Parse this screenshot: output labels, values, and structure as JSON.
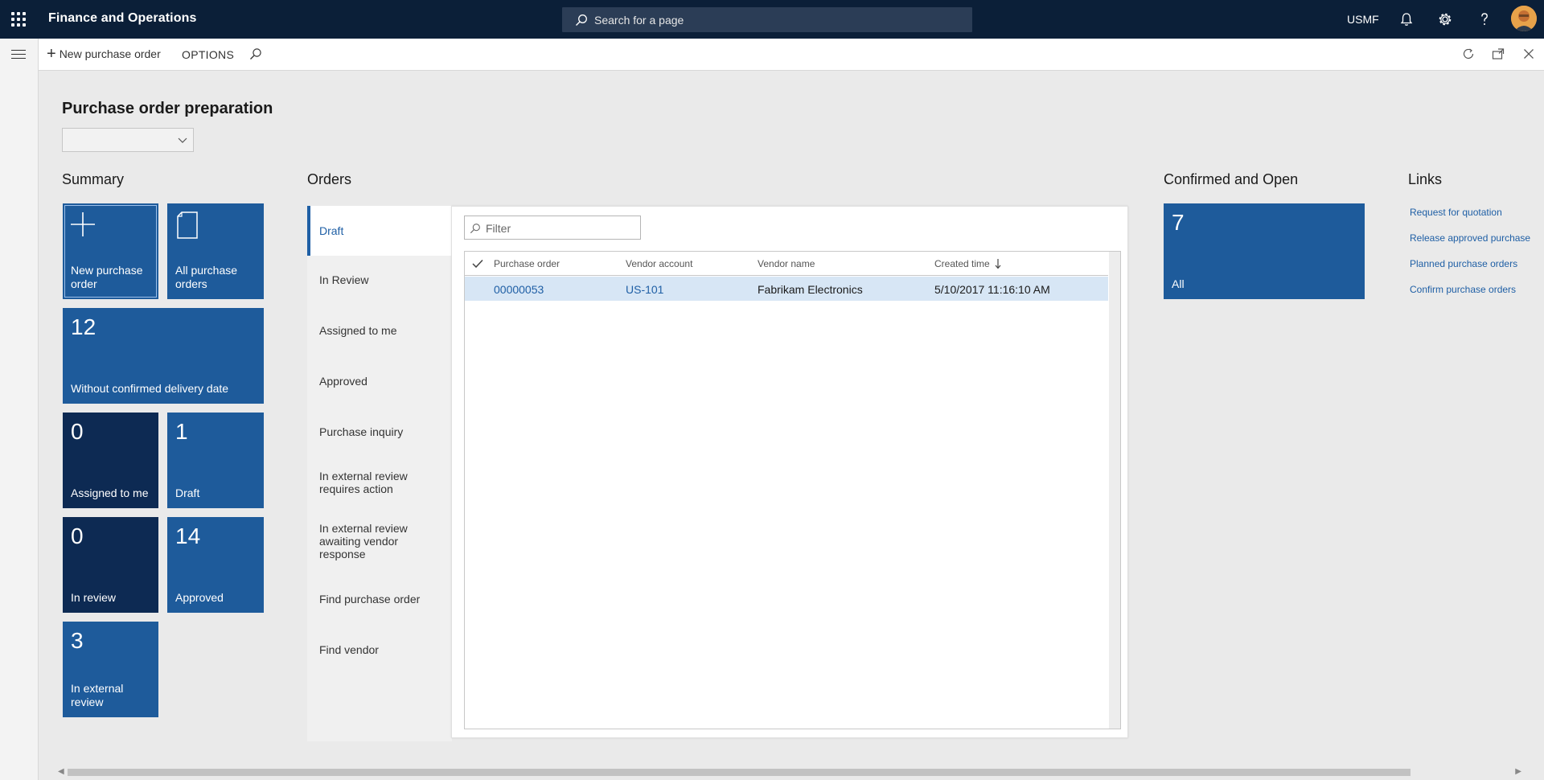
{
  "app": {
    "title": "Finance and Operations",
    "search_placeholder": "Search for a page",
    "company": "USMF"
  },
  "actions": {
    "new_purchase_order": "New purchase order",
    "options": "OPTIONS"
  },
  "page": {
    "title": "Purchase order preparation",
    "dropdown_value": ""
  },
  "summary": {
    "title": "Summary",
    "tiles": [
      {
        "count": "",
        "label": "New purchase order"
      },
      {
        "count": "",
        "label": "All purchase orders"
      },
      {
        "count": "12",
        "label": "Without confirmed delivery date"
      },
      {
        "count": "0",
        "label": "Assigned to me"
      },
      {
        "count": "1",
        "label": "Draft"
      },
      {
        "count": "0",
        "label": "In review"
      },
      {
        "count": "14",
        "label": "Approved"
      },
      {
        "count": "3",
        "label": "In external review"
      }
    ]
  },
  "orders": {
    "title": "Orders",
    "tabs": [
      "Draft",
      "In Review",
      "Assigned to me",
      "Approved",
      "Purchase inquiry",
      "In external review requires action",
      "In external review awaiting vendor response",
      "Find purchase order",
      "Find vendor"
    ],
    "filter_placeholder": "Filter",
    "columns": [
      "Purchase order",
      "Vendor account",
      "Vendor name",
      "Created time"
    ],
    "rows": [
      {
        "purchase_order": "00000053",
        "vendor_account": "US-101",
        "vendor_name": "Fabrikam Electronics",
        "created_time": "5/10/2017 11:16:10 AM"
      }
    ]
  },
  "confirmed": {
    "title": "Confirmed and Open",
    "tile": {
      "count": "7",
      "label": "All"
    }
  },
  "links": {
    "title": "Links",
    "items": [
      "Request for quotation",
      "Release approved purchase",
      "Planned purchase orders",
      "Confirm purchase orders"
    ]
  },
  "colors": {
    "nav_bg": "#0b1f38",
    "tile_blue": "#1e5b9b",
    "tile_dark": "#0d2a53",
    "link": "#1f5fa5",
    "row_selected": "#d7e6f5"
  }
}
